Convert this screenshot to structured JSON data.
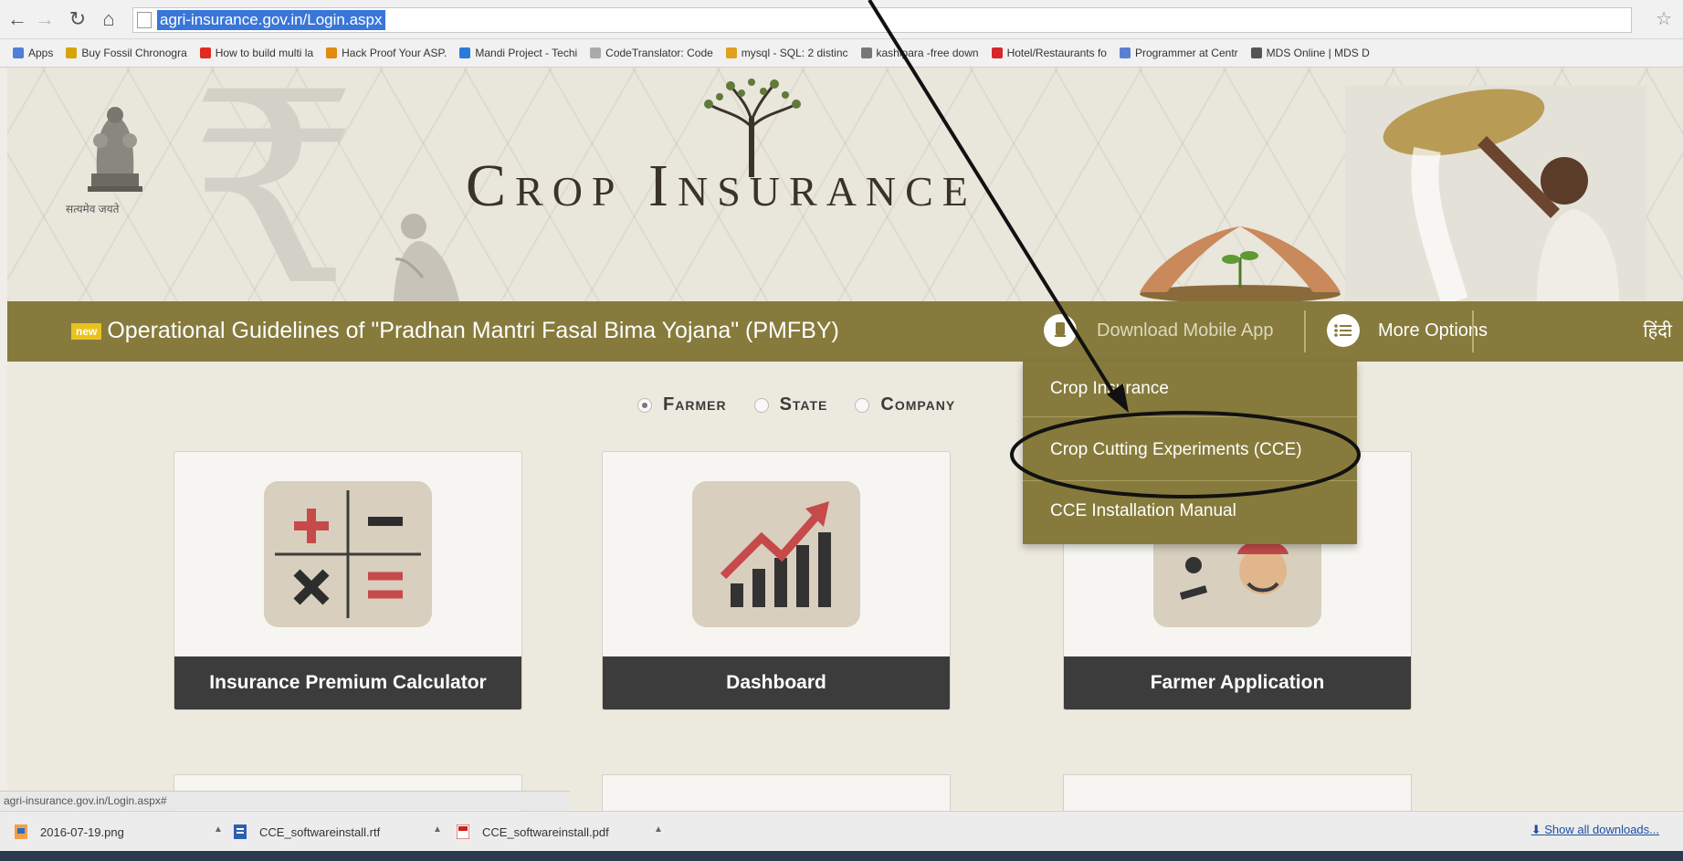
{
  "browser": {
    "url": "agri-insurance.gov.in/Login.aspx",
    "bookmarks": [
      {
        "label": "Apps",
        "color": "#4f7fd6"
      },
      {
        "label": "Buy Fossil Chronogra",
        "color": "#d8a400"
      },
      {
        "label": "How to build multi la",
        "color": "#e02b20"
      },
      {
        "label": "Hack Proof Your ASP.",
        "color": "#e08a10"
      },
      {
        "label": "Mandi Project - Techi",
        "color": "#2a7ad8"
      },
      {
        "label": "CodeTranslator: Code",
        "color": "#aaaaaa"
      },
      {
        "label": "mysql - SQL: 2 distinc",
        "color": "#e0a020"
      },
      {
        "label": "kashipara -free down",
        "color": "#777777"
      },
      {
        "label": "Hotel/Restaurants fo",
        "color": "#d8262b"
      },
      {
        "label": "Programmer at Centr",
        "color": "#5b7fd0"
      },
      {
        "label": "MDS Online | MDS D",
        "color": "#555555"
      }
    ]
  },
  "header": {
    "title": "Crop Insurance",
    "emblem_caption": "सत्यमेव जयते"
  },
  "nav": {
    "new_badge": "new",
    "news_text": "Operational Guidelines of \"Pradhan Mantri Fasal Bima Yojana\" (PMFBY)",
    "download_app": "Download Mobile App",
    "more_options": "More Options",
    "language": "हिंदी"
  },
  "dropdown": {
    "items": [
      "Crop Insurance",
      "Crop Cutting Experiments (CCE)",
      "CCE Installation Manual"
    ]
  },
  "roles": {
    "options": [
      "Farmer",
      "State",
      "Company"
    ],
    "selected": "Farmer"
  },
  "cards": [
    {
      "label": "Insurance Premium Calculator"
    },
    {
      "label": "Dashboard"
    },
    {
      "label": "Farmer Application"
    }
  ],
  "status_url": "agri-insurance.gov.in/Login.aspx#",
  "downloads": {
    "files": [
      "2016-07-19.png",
      "CCE_softwareinstall.rtf",
      "CCE_softwareinstall.pdf"
    ],
    "show_all": "Show all downloads..."
  },
  "colors": {
    "accent_olive": "#867b3c",
    "card_label_bg": "#3c3c3c",
    "calc_plus": "#c64a4a"
  }
}
